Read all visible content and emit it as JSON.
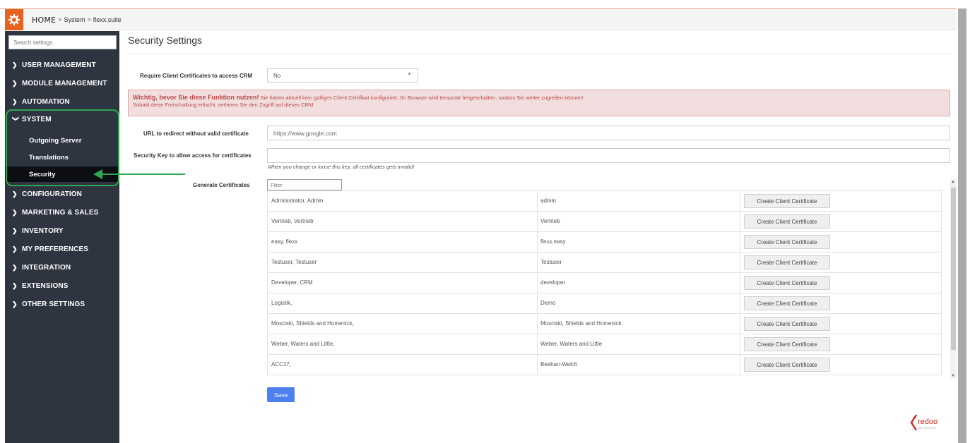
{
  "breadcrumb": {
    "home": "HOME",
    "sep1": ">",
    "system": "System",
    "sep2": ">",
    "suite": "flexx.suite"
  },
  "sidebar": {
    "search_placeholder": "Search settings",
    "items": [
      {
        "label": "USER MANAGEMENT",
        "chevron": ">"
      },
      {
        "label": "MODULE MANAGEMENT",
        "chevron": ">"
      },
      {
        "label": "AUTOMATION",
        "chevron": ">"
      },
      {
        "label": "SYSTEM",
        "chevron": "v"
      },
      {
        "label": "CONFIGURATION",
        "chevron": ">"
      },
      {
        "label": "MARKETING & SALES",
        "chevron": ">"
      },
      {
        "label": "INVENTORY",
        "chevron": ">"
      },
      {
        "label": "MY PREFERENCES",
        "chevron": ">"
      },
      {
        "label": "INTEGRATION",
        "chevron": ">"
      },
      {
        "label": "EXTENSIONS",
        "chevron": ">"
      },
      {
        "label": "OTHER SETTINGS",
        "chevron": ">"
      }
    ],
    "system_sub": [
      {
        "label": "Outgoing Server"
      },
      {
        "label": "Translations"
      },
      {
        "label": "Security"
      }
    ],
    "highlight_color": "#2fa84f"
  },
  "main": {
    "title": "Security Settings",
    "require_label": "Require Client Certificates to access CRM",
    "require_value": "No",
    "alert_bold": "Wichtig, bevor Sie diese Funktion nutzen!",
    "alert_line1": " Sie haben aktuell kein gültiges Client Certifikat konfiguriert. Ihr Browser wird temporär freigeschalten, sodass Sie weiter zugreifen können!",
    "alert_line2": "Sobald diese Freischaltung erlischt, verlieren Sie den Zugriff auf dieses CRM",
    "url_label": "URL to redirect without valid certificate",
    "url_value": "https://www.google.com",
    "key_label": "Security Key to allow access for certificates",
    "key_value": "",
    "key_hint": "When you change or loose this key, all certificates gets invalid!",
    "generate_label": "Generate Certificates",
    "filter_placeholder": "Filter",
    "cert_button_label": "Create Client Certificate",
    "rows": [
      {
        "name": "Administrator, Admin",
        "user": "admin"
      },
      {
        "name": "Vertrieb, Vertrieb",
        "user": "Vertrieb"
      },
      {
        "name": "easy, flexx",
        "user": "flexx.easy"
      },
      {
        "name": "Testuser, Testuser",
        "user": "Testuser"
      },
      {
        "name": "Developer, CRM",
        "user": "developer"
      },
      {
        "name": "Logistik,",
        "user": "Demo"
      },
      {
        "name": "Mosciski, Shields and Homenick,",
        "user": "Mosciski, Shields and Homenick"
      },
      {
        "name": "Weber, Waters and Little,",
        "user": "Weber, Waters and Little"
      },
      {
        "name": "ACC17,",
        "user": "Beahan-Welch"
      }
    ],
    "save_label": "Save"
  },
  "branding": {
    "logo_text": "redoo",
    "logo_sub": "NETWORKS"
  },
  "colors": {
    "accent_orange": "#e8621f",
    "sidebar_bg": "#2e3440",
    "save_blue": "#4d7ff0",
    "alert_bg": "#f2dede",
    "alert_text": "#b94a48"
  }
}
